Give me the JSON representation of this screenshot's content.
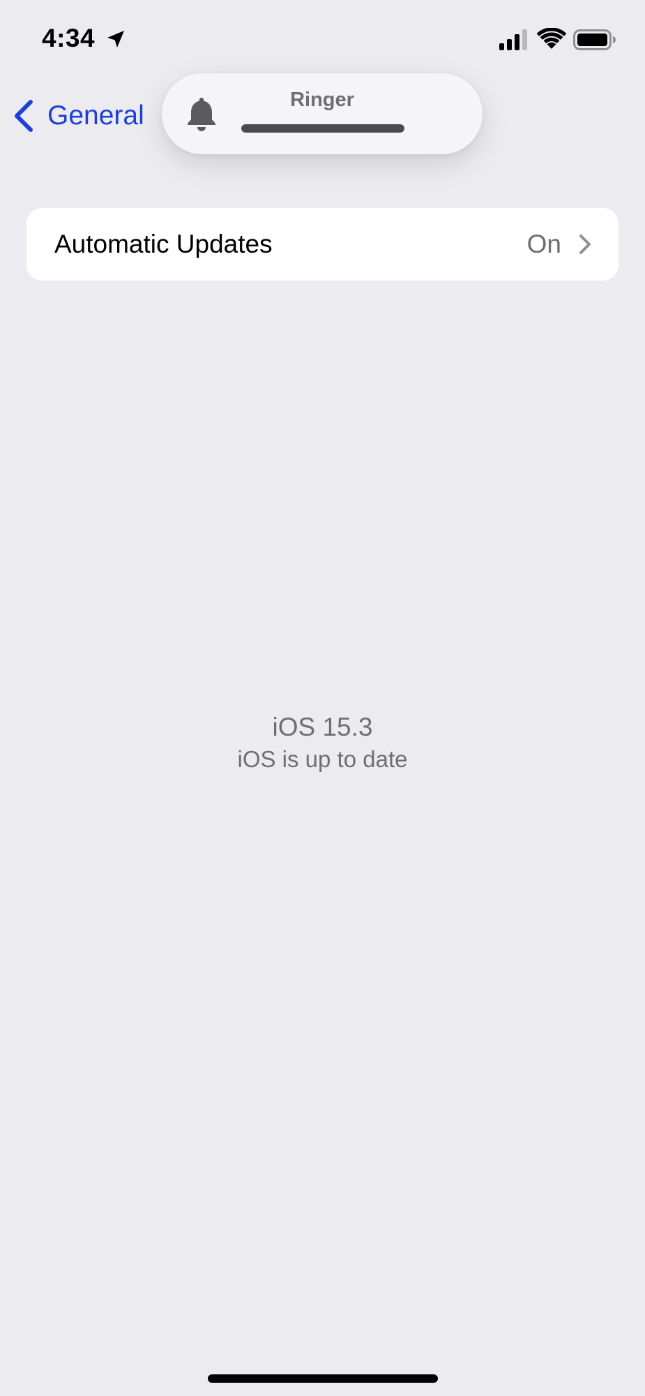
{
  "status_bar": {
    "time": "4:34",
    "icons": [
      "location-arrow-icon",
      "cellular-signal-icon",
      "wifi-icon",
      "battery-icon"
    ]
  },
  "nav": {
    "back_label": "General",
    "back_icon": "chevron-left-icon"
  },
  "ringer_hud": {
    "label": "Ringer",
    "icon": "bell-icon",
    "volume_fraction": 1.0
  },
  "settings": {
    "automatic_updates": {
      "label": "Automatic Updates",
      "value": "On",
      "icon": "chevron-right-icon"
    }
  },
  "software": {
    "version": "iOS 15.3",
    "status": "iOS is up to date"
  },
  "colors": {
    "accent": "#1e3fd8",
    "background": "#ebebf0",
    "secondary_text": "#6e6e73"
  }
}
